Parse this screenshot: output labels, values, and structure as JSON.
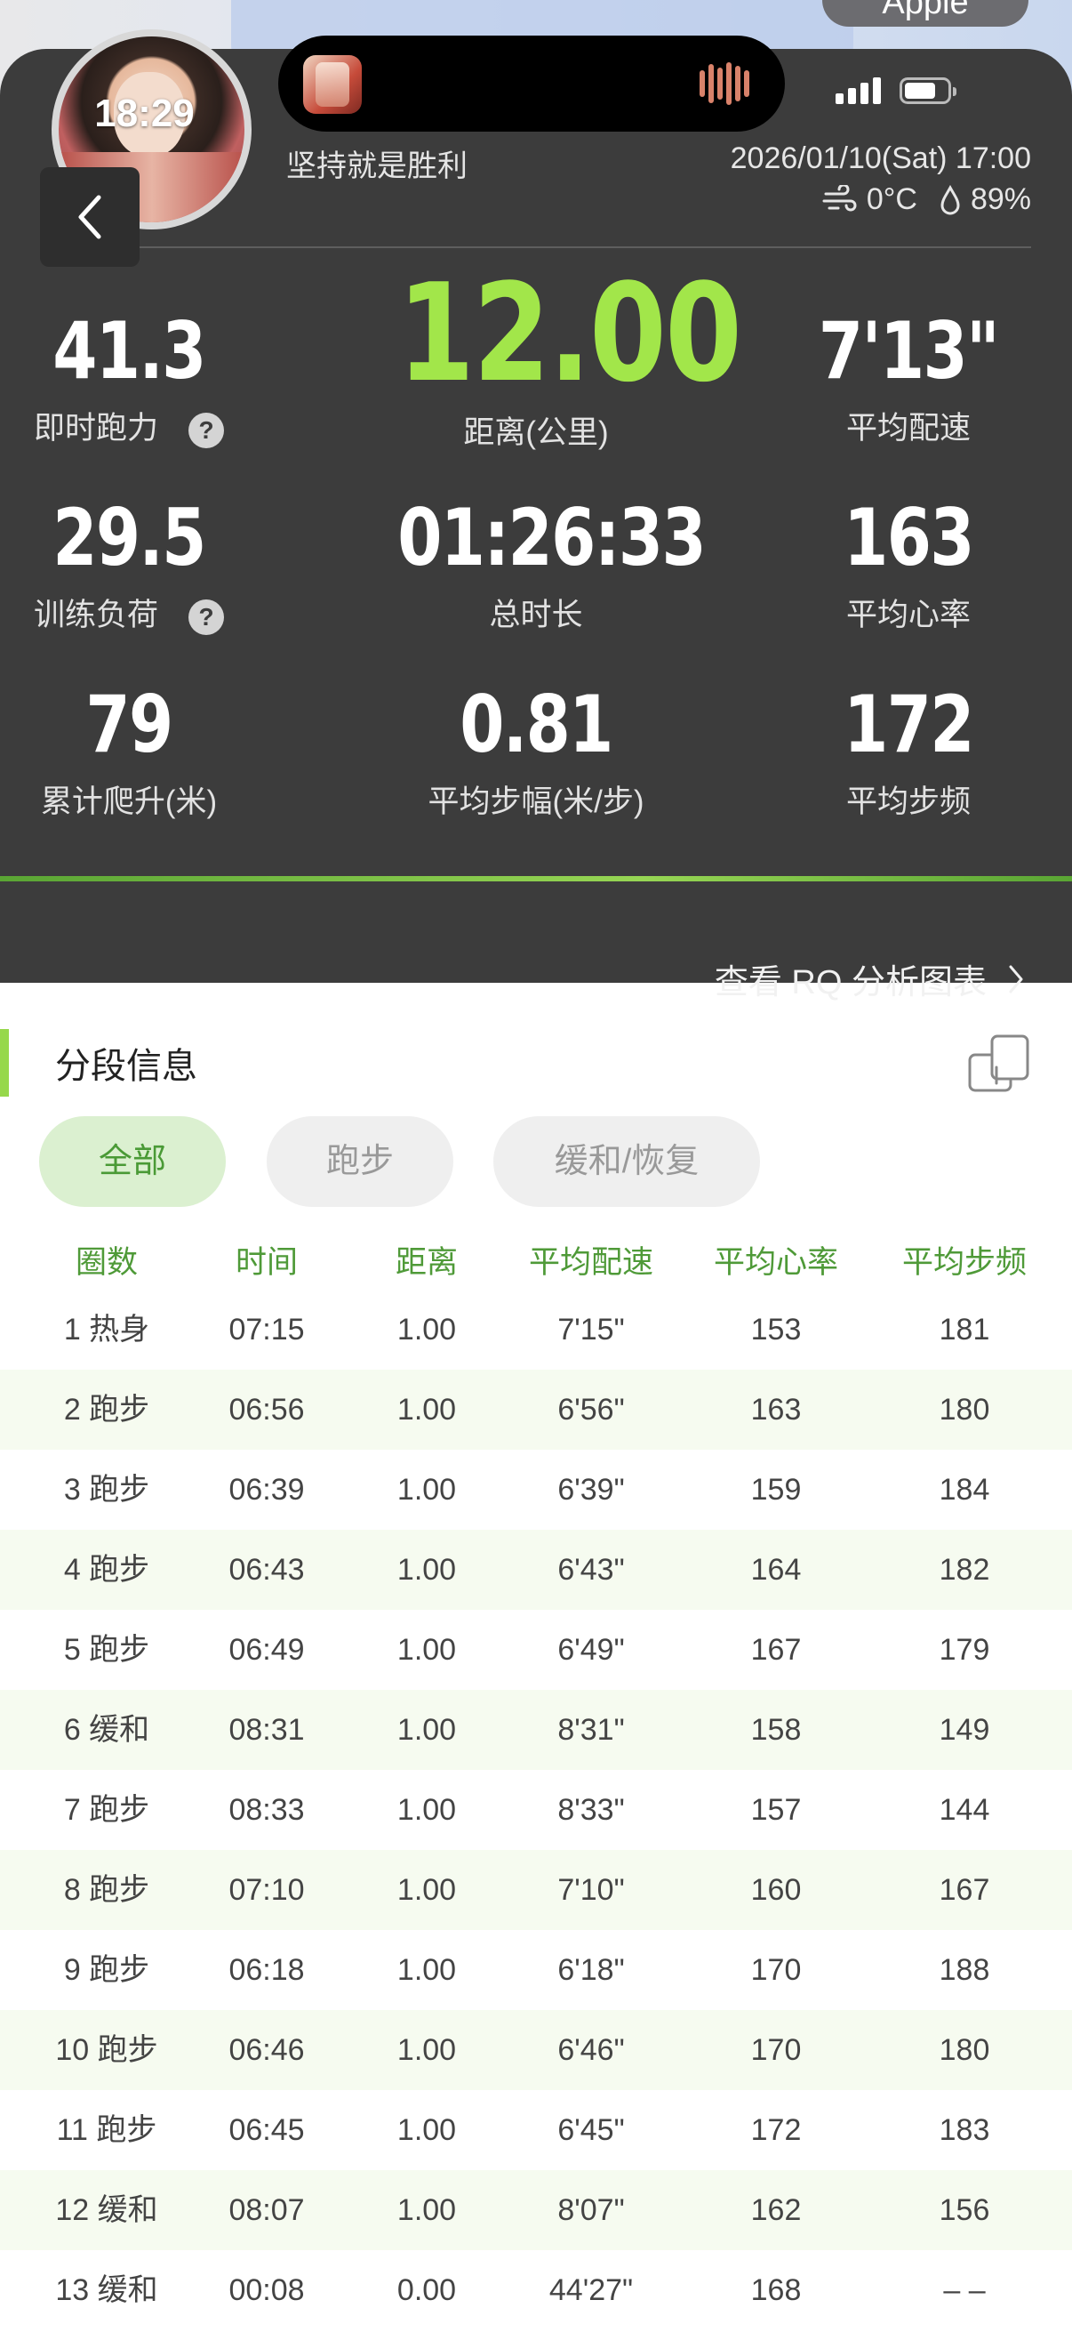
{
  "status_bar": {
    "time": "18:29",
    "apple_label": "Apple"
  },
  "header": {
    "motto": "坚持就是胜利",
    "datetime": "2026/01/10(Sat) 17:00",
    "temperature": "0°C",
    "humidity": "89%"
  },
  "stats": {
    "running_power": {
      "value": "41.3",
      "label": "即时跑力"
    },
    "distance": {
      "value": "12.00",
      "label": "距离(公里)"
    },
    "avg_pace": {
      "value": "7'13\"",
      "label": "平均配速"
    },
    "training_load": {
      "value": "29.5",
      "label": "训练负荷"
    },
    "total_time": {
      "value": "01:26:33",
      "label": "总时长"
    },
    "avg_hr": {
      "value": "163",
      "label": "平均心率"
    },
    "elevation": {
      "value": "79",
      "label": "累计爬升(米)"
    },
    "avg_stride": {
      "value": "0.81",
      "label": "平均步幅(米/步)"
    },
    "avg_cadence": {
      "value": "172",
      "label": "平均步频"
    }
  },
  "rq_link": "查看 RQ 分析图表",
  "segments": {
    "title": "分段信息",
    "tabs": [
      "全部",
      "跑步",
      "缓和/恢复"
    ],
    "columns": [
      "圈数",
      "时间",
      "距离",
      "平均配速",
      "平均心率",
      "平均步频"
    ],
    "rows": [
      [
        "1 热身",
        "07:15",
        "1.00",
        "7'15\"",
        "153",
        "181"
      ],
      [
        "2 跑步",
        "06:56",
        "1.00",
        "6'56\"",
        "163",
        "180"
      ],
      [
        "3 跑步",
        "06:39",
        "1.00",
        "6'39\"",
        "159",
        "184"
      ],
      [
        "4 跑步",
        "06:43",
        "1.00",
        "6'43\"",
        "164",
        "182"
      ],
      [
        "5 跑步",
        "06:49",
        "1.00",
        "6'49\"",
        "167",
        "179"
      ],
      [
        "6 缓和",
        "08:31",
        "1.00",
        "8'31\"",
        "158",
        "149"
      ],
      [
        "7 跑步",
        "08:33",
        "1.00",
        "8'33\"",
        "157",
        "144"
      ],
      [
        "8 跑步",
        "07:10",
        "1.00",
        "7'10\"",
        "160",
        "167"
      ],
      [
        "9 跑步",
        "06:18",
        "1.00",
        "6'18\"",
        "170",
        "188"
      ],
      [
        "10 跑步",
        "06:46",
        "1.00",
        "6'46\"",
        "170",
        "180"
      ],
      [
        "11 跑步",
        "06:45",
        "1.00",
        "6'45\"",
        "172",
        "183"
      ],
      [
        "12 缓和",
        "08:07",
        "1.00",
        "8'07\"",
        "162",
        "156"
      ],
      [
        "13 缓和",
        "00:08",
        "0.00",
        "44'27\"",
        "168",
        "– –"
      ]
    ]
  },
  "icons": {
    "back": "chevron-left-icon",
    "help": "question-mark-icon",
    "wind": "wind-icon",
    "humidity": "droplet-icon",
    "share": "share-export-icon",
    "more": "chevron-right-icon"
  },
  "colors": {
    "accent_green": "#a2e64a",
    "dark_panel": "#3c3c3c",
    "table_header_green": "#4f9a38"
  }
}
